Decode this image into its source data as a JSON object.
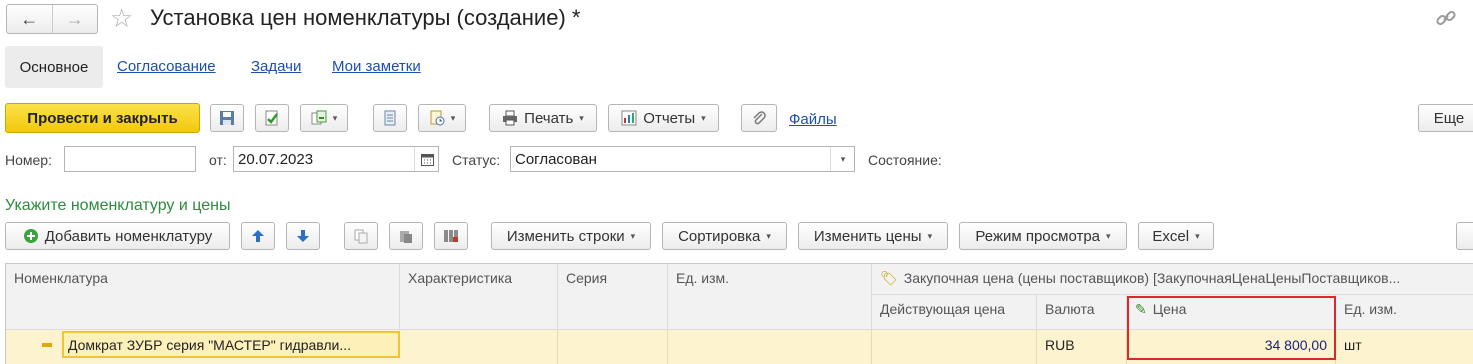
{
  "window": {
    "title": "Установка цен номенклатуры (создание) *",
    "back_icon": "←",
    "forward_icon": "→"
  },
  "tabs": [
    {
      "label": "Основное"
    },
    {
      "label": "Согласование"
    },
    {
      "label": "Задачи"
    },
    {
      "label": "Мои заметки"
    }
  ],
  "toolbar": {
    "post_close": "Провести и закрыть",
    "print": "Печать",
    "reports": "Отчеты",
    "files": "Файлы",
    "more": "Еще"
  },
  "form": {
    "number_label": "Номер:",
    "number_value": "",
    "date_label": "от:",
    "date_value": "20.07.2023",
    "status_label": "Статус:",
    "status_value": "Согласован",
    "state_label": "Состояние:"
  },
  "section_title": "Укажите номенклатуру и цены",
  "table_toolbar": {
    "add_item": "Добавить номенклатуру",
    "change_rows": "Изменить строки",
    "sort": "Сортировка",
    "change_prices": "Изменить цены",
    "view_mode": "Режим просмотра",
    "excel": "Excel"
  },
  "grid": {
    "headers": {
      "item": "Номенклатура",
      "characteristic": "Характеристика",
      "series": "Серия",
      "unit": "Ед. изм.",
      "purchase_group": "Закупочная цена  (цены поставщиков) [ЗакупочнаяЦенаЦеныПоставщиков...",
      "current_price": "Действующая цена",
      "currency": "Валюта",
      "price": "Цена",
      "price_unit": "Ед. изм."
    },
    "rows": [
      {
        "item": "Домкрат ЗУБР серия \"МАСТЕР\" гидравли...",
        "characteristic": "",
        "series": "",
        "unit": "",
        "current_price": "",
        "currency": "RUB",
        "price": "34 800,00",
        "price_unit": "шт"
      }
    ]
  },
  "colors": {
    "primary_button": "#f2c80c",
    "section_title": "#2e8b3d",
    "highlight_border": "#d9292b",
    "row_bg": "#fdf4cf"
  }
}
